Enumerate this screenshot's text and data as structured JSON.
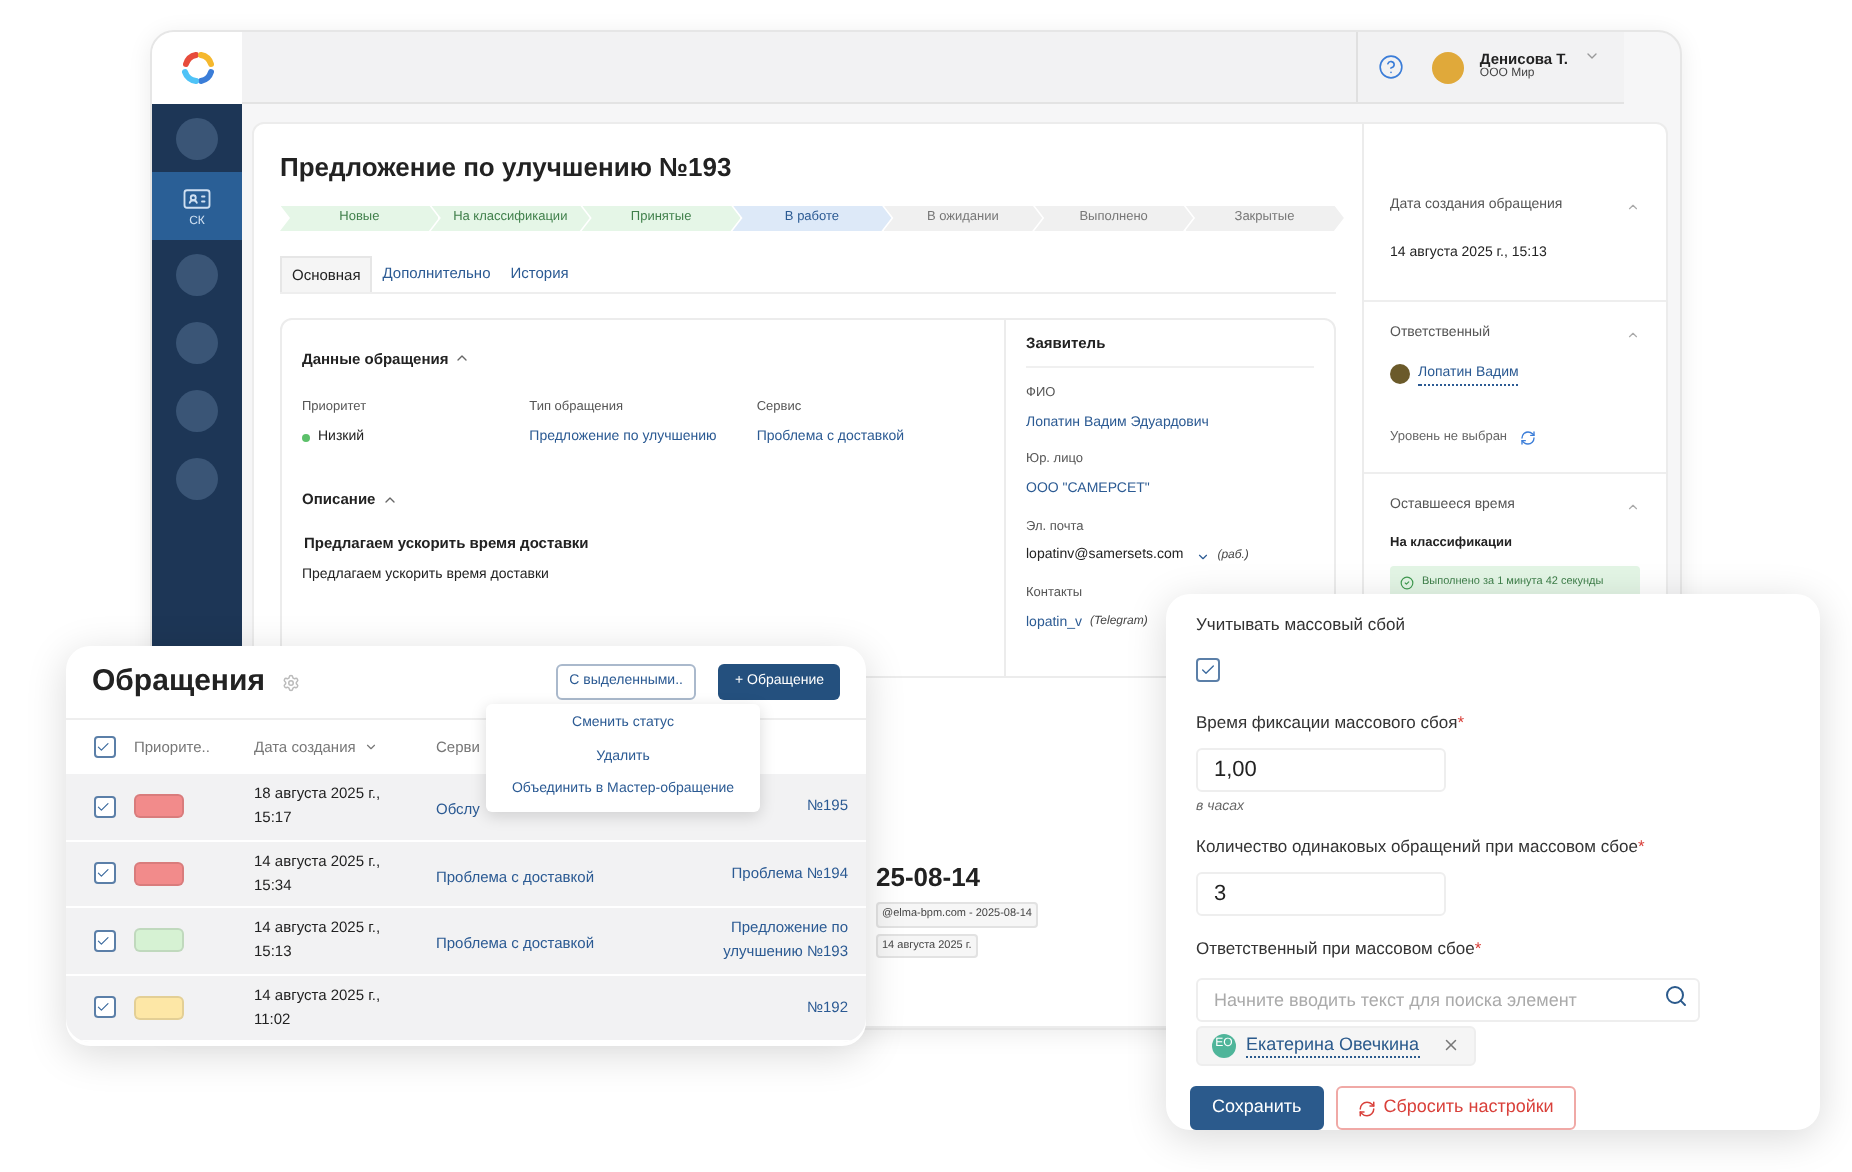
{
  "sidebar": {
    "items": [
      {
        "kind": "blank",
        "selected": false
      },
      {
        "kind": "card",
        "label": "СК",
        "selected": true
      },
      {
        "kind": "blank",
        "selected": false
      },
      {
        "kind": "blank",
        "selected": false
      },
      {
        "kind": "blank",
        "selected": false
      },
      {
        "kind": "blank",
        "selected": false
      }
    ]
  },
  "header": {
    "user_name": "Денисова Т.",
    "user_org": "ООО Мир"
  },
  "ticket": {
    "title": "Предложение по улучшению №193",
    "stages": [
      {
        "label": "Новые",
        "done": true,
        "current": false
      },
      {
        "label": "На классификации",
        "done": true,
        "current": false
      },
      {
        "label": "Принятые",
        "done": true,
        "current": false
      },
      {
        "label": "В работе",
        "done": false,
        "current": true
      },
      {
        "label": "В ожидании",
        "done": false,
        "current": false
      },
      {
        "label": "Выполнено",
        "done": false,
        "current": false
      },
      {
        "label": "Закрытые",
        "done": false,
        "current": false
      }
    ],
    "tabs": [
      {
        "label": "Основная",
        "selected": true
      },
      {
        "label": "Дополнительно",
        "selected": false
      },
      {
        "label": "История",
        "selected": false
      }
    ],
    "data_section": {
      "title": "Данные обращения",
      "fields": [
        {
          "label": "Приоритет",
          "value": "Низкий",
          "kind": "dot",
          "color": "#5cc06a"
        },
        {
          "label": "Тип обращения",
          "value": "Предложение по улучшению",
          "kind": "link"
        },
        {
          "label": "Сервис",
          "value": "Проблема с доставкой",
          "kind": "link"
        }
      ]
    },
    "description": {
      "title": "Описание",
      "heading": "Предлагаем ускорить время доставки",
      "text": "Предлагаем ускорить время доставки"
    },
    "applicant": {
      "title": "Заявитель",
      "fields": [
        {
          "label": "ФИО",
          "value": "Лопатин Вадим Эдуардович"
        },
        {
          "label": "Юр. лицо",
          "value": "ООО \"САМЕРСЕТ\""
        },
        {
          "label": "Эл. почта",
          "value": "lopatinv@samersets.com",
          "note": "(раб.)",
          "dropdown": true
        },
        {
          "label": "Контакты",
          "value": "lopatin_v",
          "note": "(Telegram)"
        }
      ]
    },
    "history": {
      "title": "25-08-14",
      "chips": [
        "@elma-bpm.com - 2025-08-14",
        "14 августа 2025 г."
      ]
    },
    "aside": {
      "created_label": "Дата создания обращения",
      "created_value": "14 августа 2025 г., 15:13",
      "responsible_label": "Ответственный",
      "responsible_name": "Лопатин Вадим",
      "level_text": "Уровень не выбран",
      "remaining_label": "Оставшееся время",
      "stage_name": "На классификации",
      "stage_result": "Выполнено за 1 минута 42 секунды"
    }
  },
  "requests": {
    "title": "Обращения",
    "bulk_button": "С выделенными..",
    "add_button": "+ Обращение",
    "bulk_menu": [
      "Сменить статус",
      "Удалить",
      "Объединить в Мастер-обращение"
    ],
    "header_checked": true,
    "columns": [
      "Приорите..",
      "Дата создания",
      "Серви"
    ],
    "rows": [
      {
        "checked": true,
        "color": "#f28b8b",
        "date": "18 августа 2025 г., 15:17",
        "service": "Обслу",
        "column_5": "№195"
      },
      {
        "checked": true,
        "color": "#f28b8b",
        "date": "14 августа 2025 г., 15:34",
        "service": "Проблема с доставкой",
        "column_5": "Проблема  №194"
      },
      {
        "checked": true,
        "color": "#d6f2d3",
        "date": "14 августа 2025 г., 15:13",
        "service": "Проблема с доставкой",
        "column_5": "Предложение по улучшению  №193"
      },
      {
        "checked": true,
        "color": "#fde7a6",
        "date": "14 августа 2025 г., 11:02",
        "service": "",
        "column_5": "№192"
      }
    ]
  },
  "mass_failure": {
    "account_label": "Учитывать массовый сбой",
    "account_checked": true,
    "fields": [
      {
        "label": "Время фиксации массового сбоя",
        "mark": "*",
        "value": "1,00",
        "hint": "в часах"
      },
      {
        "label": "Количество одинаковых обращений при массовом сбое",
        "mark": "*",
        "value": "3"
      }
    ],
    "responsible": {
      "label": "Ответственный при массовом сбое",
      "mark": "*",
      "placeholder": "Начните вводить текст для поиска элемент",
      "chips": [
        {
          "initials": "ЕО",
          "name": "Екатерина Овечкина"
        }
      ]
    },
    "buttons": [
      {
        "label": "Сохранить",
        "kind": "primary"
      },
      {
        "label": "Сбросить настройки",
        "kind": "reset"
      }
    ]
  }
}
